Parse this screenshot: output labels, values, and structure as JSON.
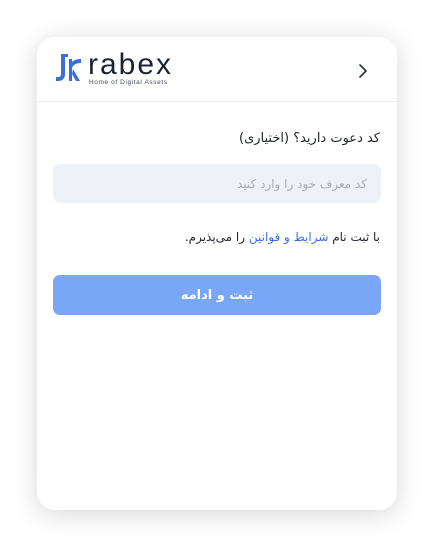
{
  "brand": {
    "name": "rabex",
    "tagline": "Home of Digital Assets",
    "logo_icon": "rabex-logo-mark",
    "accent_color": "#3b6fd8"
  },
  "header": {
    "back_icon": "chevron-right-icon"
  },
  "form": {
    "invite_label": "کد دعوت دارید؟ (اختیاری)",
    "invite_value": "",
    "invite_placeholder": "کد معرف خود را وارد کنید",
    "terms_prefix": "با ثبت نام ",
    "terms_link": "شرایط و قوانین",
    "terms_suffix": " را می‌پذیرم.",
    "submit_label": "ثبت و ادامه",
    "submit_color": "#7aa6f7"
  }
}
